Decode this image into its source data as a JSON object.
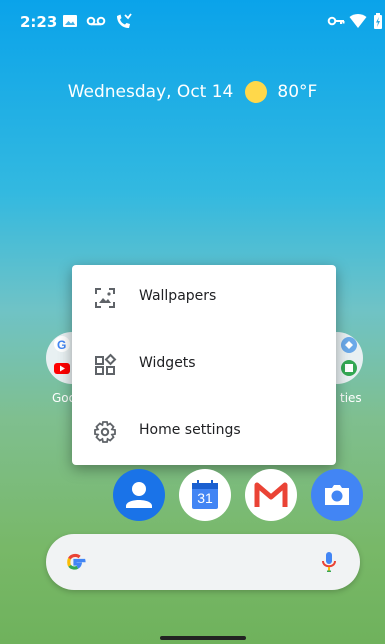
{
  "status_bar": {
    "time": "2:23",
    "left_icons": [
      "image-icon",
      "voicemail-icon",
      "missed-call-icon"
    ],
    "right_icons": [
      "vpn-key-icon",
      "wifi-icon",
      "battery-charging-icon"
    ]
  },
  "widget": {
    "date": "Wednesday, Oct 14",
    "weather_icon": "sun-icon",
    "temperature": "80°F"
  },
  "folders": {
    "left_label": "Goo",
    "right_label": "ties"
  },
  "context_menu": {
    "items": [
      {
        "label": "Wallpapers",
        "icon": "wallpaper-icon"
      },
      {
        "label": "Widgets",
        "icon": "widgets-icon"
      },
      {
        "label": "Home settings",
        "icon": "gear-icon"
      }
    ]
  },
  "dock": {
    "apps": [
      {
        "name": "contacts-icon",
        "color": "#1a73e8"
      },
      {
        "name": "calendar-icon",
        "color": "#4285f4",
        "text": "31"
      },
      {
        "name": "gmail-icon",
        "color": "#ea4335"
      },
      {
        "name": "camera-icon",
        "color": "#4285f4"
      }
    ]
  },
  "search": {
    "logo": "google-g-icon",
    "mic": "mic-icon"
  }
}
